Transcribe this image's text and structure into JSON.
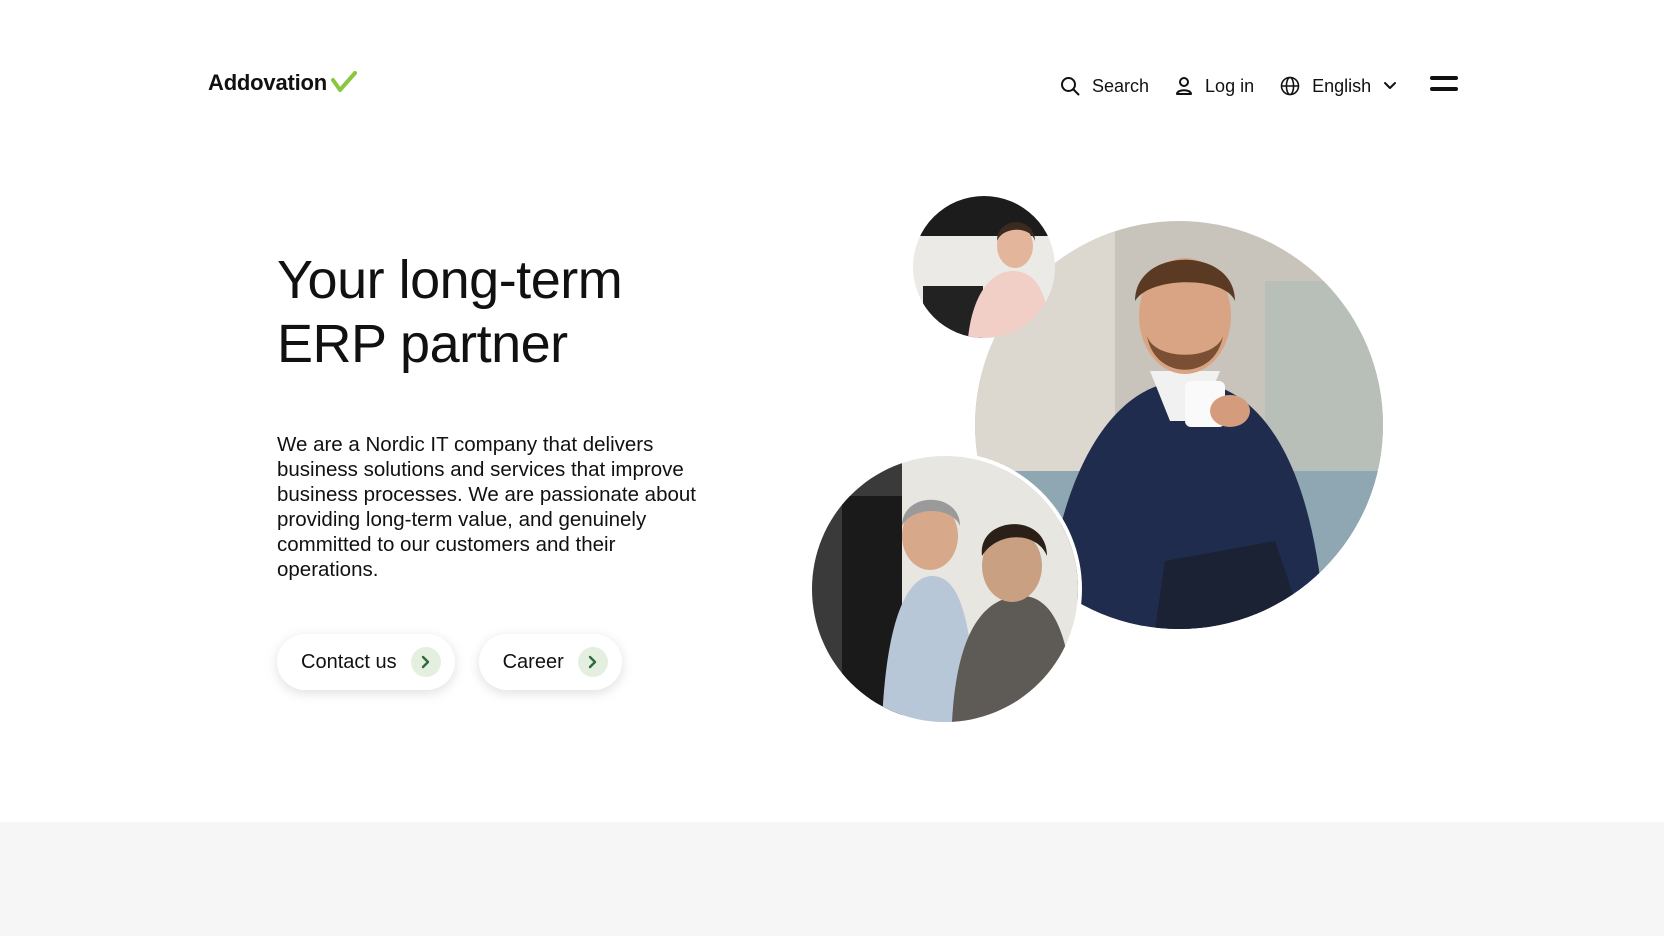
{
  "header": {
    "logo_text": "Addovation",
    "logo_check_color": "#8cc63f",
    "search_label": "Search",
    "login_label": "Log in",
    "language_label": "English"
  },
  "hero": {
    "title_line1": "Your long-term",
    "title_line2": "ERP partner",
    "description": "We are a Nordic IT company that delivers business solutions and services that improve business processes. We are passionate about providing long-term value, and genuinely committed to our customers and their operations.",
    "buttons": [
      {
        "label": "Contact us"
      },
      {
        "label": "Career"
      }
    ]
  },
  "colors": {
    "arrow_bg": "#e5efe0",
    "arrow_color": "#2f6b3a",
    "footer_band": "#f6f6f6"
  }
}
